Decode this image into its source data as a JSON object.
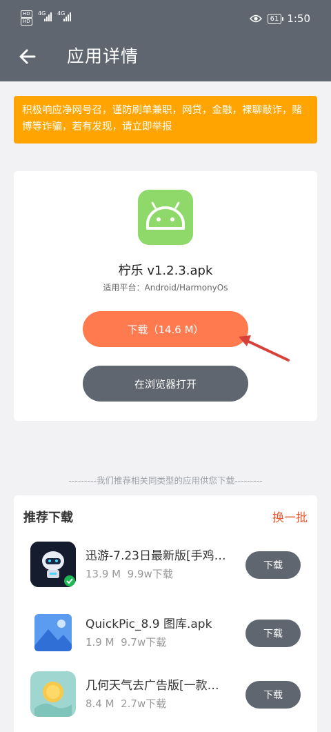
{
  "status_bar": {
    "sim1": "HD",
    "sim2": "HD",
    "net1": "4G",
    "net2": "4G",
    "battery": "61",
    "time": "1:50"
  },
  "header": {
    "title": "应用详情"
  },
  "notice": {
    "text": "积极响应净网号召，谨防刷单兼职，网贷，金融，裸聊敲诈，赌博等诈骗，若有发现，请立即举报"
  },
  "app": {
    "name": "柠乐 v1.2.3.apk",
    "platform": "适用平台：Android/HarmonyOs",
    "download_label": "下载（14.6 M）",
    "open_browser_label": "在浏览器打开"
  },
  "divider_text": "---------我们推荐相关同类型的应用供您下载---------",
  "recommend": {
    "title": "推荐下载",
    "refresh_label": "换一批",
    "items": [
      {
        "name": "迅游-7.23日最新版[手鸡…",
        "size": "13.9 M",
        "downloads": "9.9w下载",
        "button": "下载",
        "icon": "robot-app-icon"
      },
      {
        "name": "QuickPic_8.9 图库.apk",
        "size": "1.9 M",
        "downloads": "9.7w下载",
        "button": "下载",
        "icon": "gallery-app-icon"
      },
      {
        "name": "几何天气去广告版[一款…",
        "size": "8.4 M",
        "downloads": "2.7w下载",
        "button": "下载",
        "icon": "weather-app-icon"
      }
    ]
  },
  "colors": {
    "header": "#5f6670",
    "notice": "#ffa400",
    "download": "#ff7a4f",
    "accent": "#e8562e",
    "android_green": "#8fd86a"
  }
}
